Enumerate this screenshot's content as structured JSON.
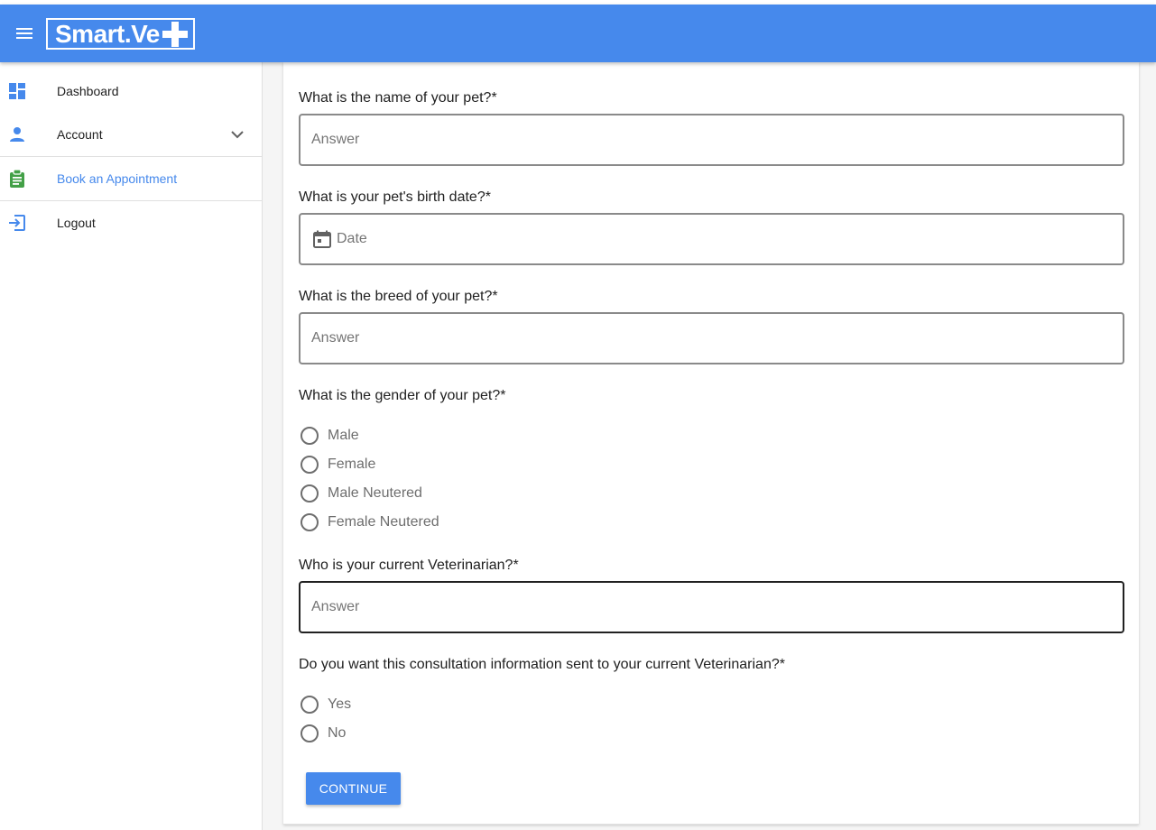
{
  "app": {
    "logo_text": "Smart.Ve",
    "brand_color": "#4689ec"
  },
  "sidebar": {
    "items": [
      {
        "label": "Dashboard",
        "icon": "dashboard-icon"
      },
      {
        "label": "Account",
        "icon": "person-icon"
      },
      {
        "label": "Book an Appointment",
        "icon": "clipboard-icon",
        "active": true
      },
      {
        "label": "Logout",
        "icon": "logout-icon"
      }
    ]
  },
  "form": {
    "pet_name": {
      "question": "What is the name of your pet?*",
      "placeholder": "Answer",
      "value": ""
    },
    "birth_date": {
      "question": "What is your pet's birth date?*",
      "placeholder": "Date",
      "value": ""
    },
    "breed": {
      "question": "What is the breed of your pet?*",
      "placeholder": "Answer",
      "value": ""
    },
    "gender": {
      "question": "What is the gender of your pet?*",
      "options": [
        "Male",
        "Female",
        "Male Neutered",
        "Female Neutered"
      ]
    },
    "veterinarian": {
      "question": "Who is your current Veterinarian?*",
      "placeholder": "Answer",
      "value": ""
    },
    "send_info": {
      "question": "Do you want this consultation information sent to your current Veterinarian?*",
      "options": [
        "Yes",
        "No"
      ]
    },
    "continue_label": "CONTINUE"
  }
}
